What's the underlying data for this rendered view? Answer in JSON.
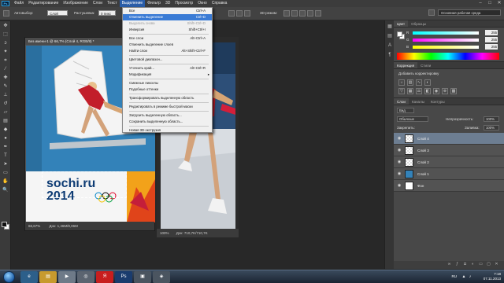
{
  "app": {
    "logo": "Ps"
  },
  "menu": [
    "Файл",
    "Редактирование",
    "Изображение",
    "Слои",
    "Текст",
    "Выделение",
    "Фильтр",
    "3D",
    "Просмотр",
    "Окно",
    "Справка"
  ],
  "window_controls": [
    "–",
    "□",
    "✕"
  ],
  "options_bar": {
    "feather_label": "Растушевка:",
    "feather_value": "0 пикс",
    "antialias_label": "Сглаживание",
    "style_label": "Стиль:",
    "style_value": "Обычный",
    "width_label": "Шир.:",
    "height_label": "Выс.:",
    "refine_edge": "Уточн. край...",
    "mode_label": "Автовыбор:",
    "mode_value": "Слой"
  },
  "workspace": {
    "label": "Основная рабочая среда"
  },
  "selection_menu": {
    "items": [
      {
        "label": "Все",
        "shortcut": "Ctrl+A",
        "state": "normal"
      },
      {
        "label": "Отменить выделение",
        "shortcut": "Ctrl+D",
        "state": "highlight"
      },
      {
        "label": "Выделить снова",
        "shortcut": "Shift+Ctrl+D",
        "state": "disabled"
      },
      {
        "label": "Инверсия",
        "shortcut": "Shift+Ctrl+I",
        "state": "normal"
      },
      {
        "sep": true
      },
      {
        "label": "Все слои",
        "shortcut": "Alt+Ctrl+A",
        "state": "normal"
      },
      {
        "label": "Отменить выделение слоев",
        "shortcut": "",
        "state": "normal"
      },
      {
        "label": "Найти слои",
        "shortcut": "Alt+Shift+Ctrl+F",
        "state": "normal"
      },
      {
        "sep": true
      },
      {
        "label": "Цветовой диапазон...",
        "shortcut": "",
        "state": "normal"
      },
      {
        "sep": true
      },
      {
        "label": "Уточнить край...",
        "shortcut": "Alt+Ctrl+R",
        "state": "normal"
      },
      {
        "label": "Модификация",
        "shortcut": "",
        "state": "normal",
        "submenu": true
      },
      {
        "sep": true
      },
      {
        "label": "Смежные пикселы",
        "shortcut": "",
        "state": "normal"
      },
      {
        "label": "Подобные оттенки",
        "shortcut": "",
        "state": "normal"
      },
      {
        "sep": true
      },
      {
        "label": "Трансформировать выделенную область",
        "shortcut": "",
        "state": "normal"
      },
      {
        "sep": true
      },
      {
        "label": "Редактировать в режиме быстрой маски",
        "shortcut": "",
        "state": "normal"
      },
      {
        "sep": true
      },
      {
        "label": "Загрузить выделенную область...",
        "shortcut": "",
        "state": "normal"
      },
      {
        "label": "Сохранить выделенную область...",
        "shortcut": "",
        "state": "normal"
      },
      {
        "sep": true
      },
      {
        "label": "Новая 3D-экструзия",
        "shortcut": "",
        "state": "normal"
      }
    ]
  },
  "doc1": {
    "title": "Без имени-1 @ 66,7% (Слой 4, RGB/8) *",
    "zoom": "66,67%",
    "doc_size": "Док: 1,46M/8,06M",
    "logo_text_1": "sochi.ru",
    "logo_text_2": "2014"
  },
  "doc2": {
    "title": "@ 100% (RGB/8)",
    "zoom": "100%",
    "doc_size": "Док: 710,7K/710,7K"
  },
  "color_panel": {
    "tabs": [
      "Цвет",
      "Образцы"
    ],
    "channels": [
      {
        "label": "R",
        "value": "255",
        "color": "#ff4040"
      },
      {
        "label": "G",
        "value": "255",
        "color": "#40ff40"
      },
      {
        "label": "B",
        "value": "255",
        "color": "#4060ff"
      }
    ]
  },
  "adjust_panel": {
    "tabs": [
      "Коррекция",
      "Стили"
    ],
    "subtitle": "Добавить корректировку"
  },
  "layers_panel": {
    "tabs": [
      "Слои",
      "Каналы",
      "Контуры"
    ],
    "kind_label": "Вид",
    "blend_mode": "Обычные",
    "opacity_label": "Непрозрачность:",
    "opacity_value": "100%",
    "lock_label": "Закрепить:",
    "fill_label": "Заливка:",
    "fill_value": "100%",
    "layers": [
      {
        "name": "Слой 4",
        "selected": true
      },
      {
        "name": "Слой 3",
        "selected": false
      },
      {
        "name": "Слой 2",
        "selected": false
      },
      {
        "name": "Слой 1",
        "selected": false
      },
      {
        "name": "Фон",
        "selected": false
      }
    ]
  },
  "taskbar": {
    "lang": "RU",
    "time": "7:18",
    "date": "07.11.2013"
  }
}
